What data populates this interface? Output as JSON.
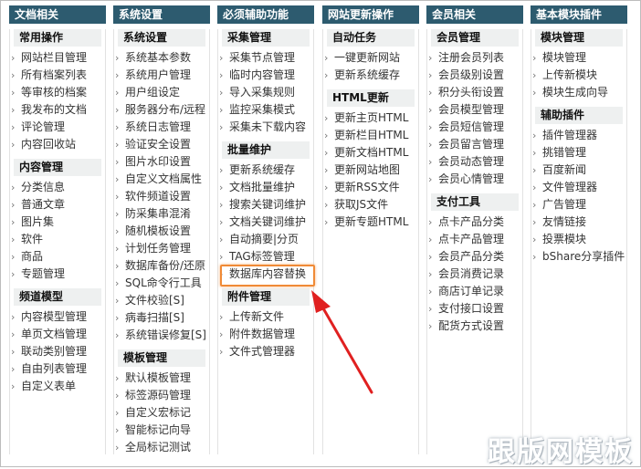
{
  "columns": [
    {
      "title": "文档相关",
      "groups": [
        {
          "title": "常用操作",
          "items": [
            "网站栏目管理",
            "所有档案列表",
            "等审核的档案",
            "我发布的文档",
            "评论管理",
            "内容回收站"
          ]
        },
        {
          "title": "内容管理",
          "items": [
            "分类信息",
            "普通文章",
            "图片集",
            "软件",
            "商品",
            "专题管理"
          ]
        },
        {
          "title": "频道模型",
          "items": [
            "内容模型管理",
            "单页文档管理",
            "联动类别管理",
            "自由列表管理",
            "自定义表单"
          ]
        }
      ]
    },
    {
      "title": "系统设置",
      "groups": [
        {
          "title": "系统设置",
          "items": [
            "系统基本参数",
            "系统用户管理",
            "用户组设定",
            "服务器分布/远程",
            "系统日志管理",
            "验证安全设置",
            "图片水印设置",
            "自定义文档属性",
            "软件频道设置",
            "防采集串混淆",
            "随机模板设置",
            "计划任务管理",
            "数据库备份/还原",
            "SQL命令行工具",
            "文件校验[S]",
            "病毒扫描[S]",
            "系统错误修复[S]"
          ]
        },
        {
          "title": "模板管理",
          "items": [
            "默认模板管理",
            "标签源码管理",
            "自定义宏标记",
            "智能标记向导",
            "全局标记测试"
          ]
        }
      ]
    },
    {
      "title": "必须辅助功能",
      "groups": [
        {
          "title": "采集管理",
          "items": [
            "采集节点管理",
            "临时内容管理",
            "导入采集规则",
            "监控采集模式",
            "采集未下载内容"
          ]
        },
        {
          "title": "批量维护",
          "items": [
            "更新系统缓存",
            "文档批量维护",
            "搜索关键词维护",
            "文档关键词维护",
            "自动摘要|分页",
            "TAG标签管理",
            "数据库内容替换"
          ]
        },
        {
          "title": "附件管理",
          "items": [
            "上传新文件",
            "附件数据管理",
            "文件式管理器"
          ]
        }
      ]
    },
    {
      "title": "网站更新操作",
      "groups": [
        {
          "title": "自动任务",
          "items": [
            "一键更新网站",
            "更新系统缓存"
          ]
        },
        {
          "title": "HTML更新",
          "items": [
            "更新主页HTML",
            "更新栏目HTML",
            "更新文档HTML",
            "更新网站地图",
            "更新RSS文件",
            "获取JS文件",
            "更新专题HTML"
          ]
        }
      ]
    },
    {
      "title": "会员相关",
      "groups": [
        {
          "title": "会员管理",
          "items": [
            "注册会员列表",
            "会员级别设置",
            "积分头衔设置",
            "会员模型管理",
            "会员短信管理",
            "会员留言管理",
            "会员动态管理",
            "会员心情管理"
          ]
        },
        {
          "title": "支付工具",
          "items": [
            "点卡产品分类",
            "点卡产品管理",
            "会员产品分类",
            "会员消费记录",
            "商店订单记录",
            "支付接口设置",
            "配货方式设置"
          ]
        }
      ]
    },
    {
      "title": "基本模块插件",
      "groups": [
        {
          "title": "模块管理",
          "items": [
            "模块管理",
            "上传新模块",
            "模块生成向导"
          ]
        },
        {
          "title": "辅助插件",
          "items": [
            "插件管理器",
            "挑错管理",
            "百度新闻",
            "文件管理器",
            "广告管理",
            "友情链接",
            "投票模块",
            "bShare分享插件"
          ]
        }
      ]
    }
  ],
  "watermark": "跟版网模板",
  "colors": {
    "header_bg": "#2d5b6f",
    "highlight": "#f08a36",
    "arrow": "#e02020"
  }
}
